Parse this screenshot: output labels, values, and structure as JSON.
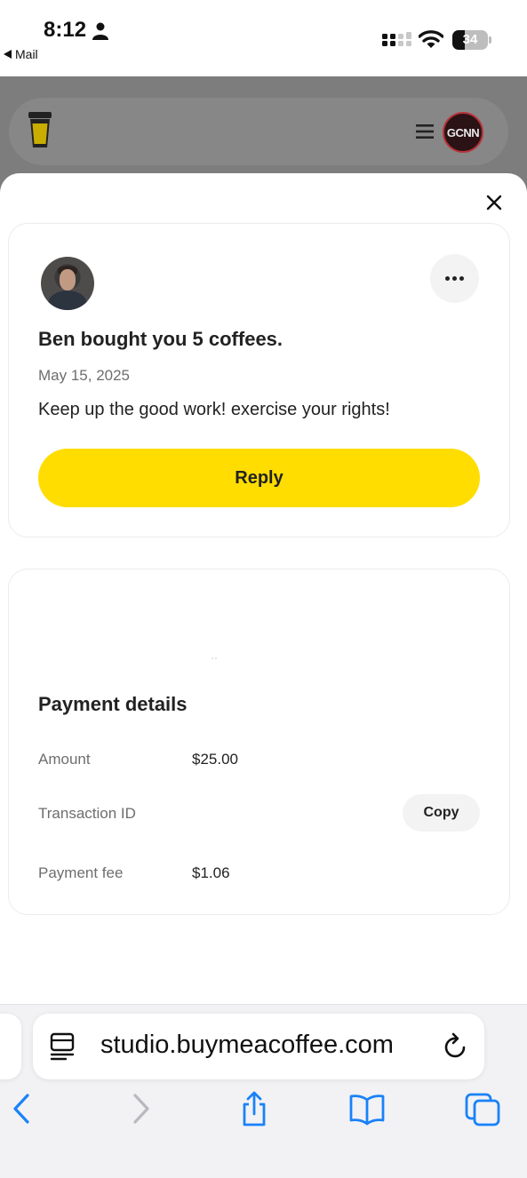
{
  "status_bar": {
    "time": "8:12",
    "back_app": "Mail",
    "battery_percent": "34"
  },
  "site_header": {
    "channel_avatar_text": "GCNN"
  },
  "support_card": {
    "title": "Ben bought you 5 coffees.",
    "date": "May 15, 2025",
    "message": "Keep up the good work! exercise your rights!",
    "reply_label": "Reply"
  },
  "payment": {
    "title": "Payment details",
    "rows": [
      {
        "label": "Amount",
        "value": "$25.00"
      },
      {
        "label": "Transaction ID",
        "value": ""
      },
      {
        "label": "Payment fee",
        "value": "$1.06"
      }
    ],
    "copy_label": "Copy"
  },
  "browser": {
    "url": "studio.buymeacoffee.com"
  },
  "colors": {
    "accent_yellow": "#ffdd00",
    "browser_blue": "#1a82f7",
    "dim_overlay": "#7d7d7d"
  }
}
